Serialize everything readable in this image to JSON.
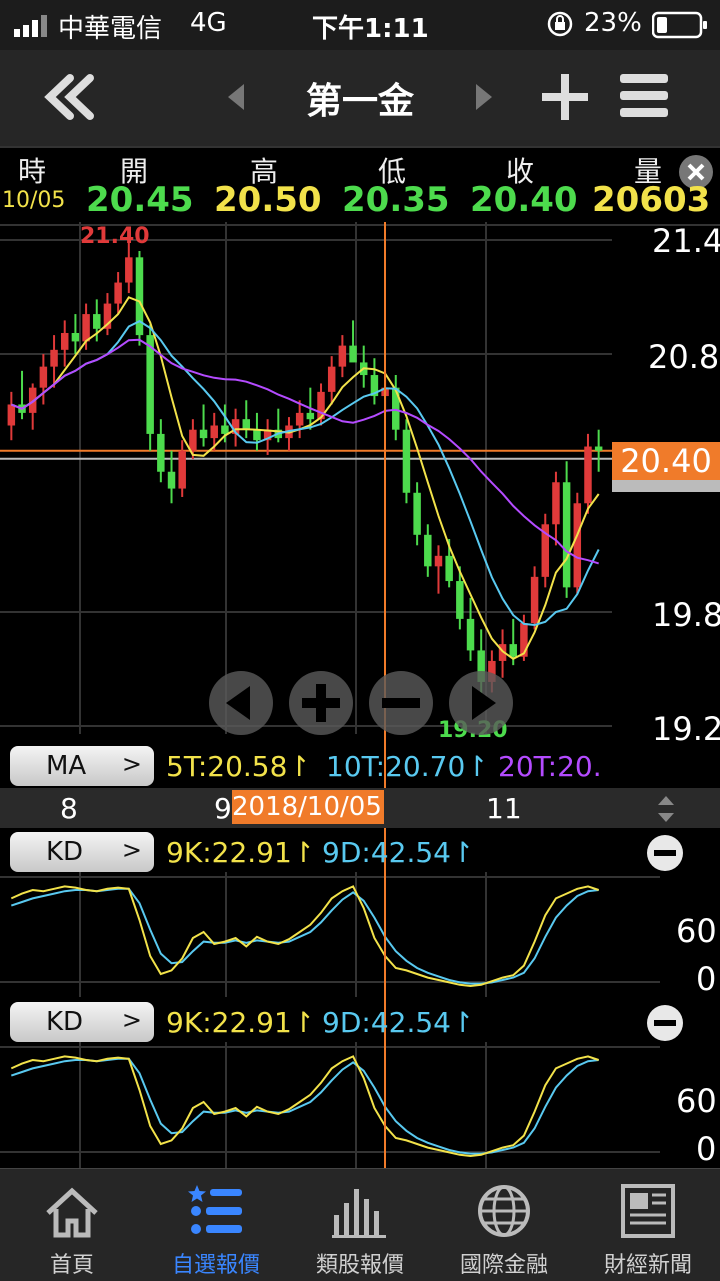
{
  "status": {
    "carrier": "中華電信",
    "network": "4G",
    "time": "下午1:11",
    "battery": "23%"
  },
  "nav": {
    "title": "第一金"
  },
  "quote": {
    "headers": [
      "時",
      "開",
      "高",
      "低",
      "收",
      "量"
    ],
    "date": "10/05",
    "open": "20.45",
    "high": "20.50",
    "low": "20.35",
    "close": "20.40",
    "volume": "20603"
  },
  "chart_data": {
    "type": "candlestick",
    "price_axis": [
      "21.4",
      "20.8",
      "19.8",
      "19.2"
    ],
    "current_price": "20.40",
    "high_label": "21.40",
    "low_label": "19.20",
    "date_axis": [
      "8",
      "9",
      "11"
    ],
    "cursor_date": "2018/10/05",
    "ylim": [
      19.1,
      21.45
    ],
    "candles": [
      [
        20.52,
        20.68,
        20.45,
        20.62
      ],
      [
        20.62,
        20.78,
        20.55,
        20.58
      ],
      [
        20.58,
        20.72,
        20.5,
        20.7
      ],
      [
        20.7,
        20.86,
        20.62,
        20.8
      ],
      [
        20.8,
        20.95,
        20.7,
        20.88
      ],
      [
        20.88,
        21.02,
        20.8,
        20.96
      ],
      [
        20.96,
        21.05,
        20.86,
        20.92
      ],
      [
        20.92,
        21.1,
        20.88,
        21.05
      ],
      [
        21.05,
        21.12,
        20.92,
        20.98
      ],
      [
        20.98,
        21.15,
        20.95,
        21.1
      ],
      [
        21.1,
        21.25,
        21.05,
        21.2
      ],
      [
        21.2,
        21.4,
        21.15,
        21.32
      ],
      [
        21.32,
        21.35,
        20.9,
        20.95
      ],
      [
        20.95,
        21.0,
        20.4,
        20.48
      ],
      [
        20.48,
        20.55,
        20.25,
        20.3
      ],
      [
        20.3,
        20.4,
        20.15,
        20.22
      ],
      [
        20.22,
        20.45,
        20.18,
        20.4
      ],
      [
        20.4,
        20.55,
        20.36,
        20.5
      ],
      [
        20.5,
        20.62,
        20.42,
        20.46
      ],
      [
        20.46,
        20.58,
        20.4,
        20.52
      ],
      [
        20.52,
        20.62,
        20.44,
        20.48
      ],
      [
        20.48,
        20.6,
        20.42,
        20.55
      ],
      [
        20.55,
        20.64,
        20.46,
        20.5
      ],
      [
        20.5,
        20.58,
        20.4,
        20.45
      ],
      [
        20.45,
        20.55,
        20.38,
        20.5
      ],
      [
        20.5,
        20.6,
        20.44,
        20.46
      ],
      [
        20.46,
        20.56,
        20.4,
        20.52
      ],
      [
        20.52,
        20.64,
        20.46,
        20.58
      ],
      [
        20.58,
        20.7,
        20.5,
        20.55
      ],
      [
        20.55,
        20.72,
        20.52,
        20.68
      ],
      [
        20.68,
        20.85,
        20.62,
        20.8
      ],
      [
        20.8,
        20.95,
        20.75,
        20.9
      ],
      [
        20.9,
        21.02,
        20.84,
        20.82
      ],
      [
        20.82,
        20.9,
        20.7,
        20.76
      ],
      [
        20.76,
        20.84,
        20.62,
        20.66
      ],
      [
        20.66,
        20.78,
        20.58,
        20.7
      ],
      [
        20.7,
        20.76,
        20.45,
        20.5
      ],
      [
        20.5,
        20.55,
        20.15,
        20.2
      ],
      [
        20.2,
        20.25,
        19.95,
        20.0
      ],
      [
        20.0,
        20.05,
        19.8,
        19.85
      ],
      [
        19.85,
        19.95,
        19.72,
        19.9
      ],
      [
        19.9,
        19.98,
        19.75,
        19.78
      ],
      [
        19.78,
        19.85,
        19.55,
        19.6
      ],
      [
        19.6,
        19.7,
        19.4,
        19.45
      ],
      [
        19.45,
        19.55,
        19.2,
        19.3
      ],
      [
        19.3,
        19.45,
        19.25,
        19.4
      ],
      [
        19.4,
        19.55,
        19.32,
        19.48
      ],
      [
        19.48,
        19.6,
        19.38,
        19.42
      ],
      [
        19.42,
        19.62,
        19.4,
        19.58
      ],
      [
        19.58,
        19.85,
        19.55,
        19.8
      ],
      [
        19.8,
        20.1,
        19.75,
        20.05
      ],
      [
        20.05,
        20.3,
        19.95,
        20.25
      ],
      [
        20.25,
        20.35,
        19.7,
        19.75
      ],
      [
        19.75,
        20.2,
        19.72,
        20.15
      ],
      [
        20.15,
        20.48,
        20.1,
        20.42
      ],
      [
        20.42,
        20.5,
        20.3,
        20.4
      ]
    ],
    "ma": [
      {
        "name": "5T",
        "value": "20.58",
        "color": "#f2e24a"
      },
      {
        "name": "10T",
        "value": "20.70",
        "color": "#59c9f0"
      },
      {
        "name": "20T",
        "value": "20.",
        "color": "#b44bff"
      }
    ],
    "kd": {
      "k_label": "9K",
      "k_value": "22.91",
      "d_label": "9D",
      "d_value": "42.54",
      "axis": [
        "60",
        "0"
      ],
      "k": [
        78,
        82,
        85,
        84,
        86,
        88,
        87,
        85,
        84,
        86,
        87,
        86,
        60,
        30,
        15,
        18,
        28,
        45,
        50,
        40,
        42,
        45,
        38,
        46,
        42,
        40,
        44,
        50,
        56,
        66,
        78,
        84,
        88,
        70,
        45,
        30,
        20,
        18,
        15,
        12,
        10,
        8,
        6,
        5,
        6,
        9,
        12,
        14,
        22,
        42,
        64,
        78,
        82,
        86,
        88,
        85
      ],
      "d": [
        72,
        75,
        78,
        80,
        82,
        84,
        85,
        85,
        84,
        85,
        86,
        86,
        74,
        52,
        32,
        24,
        25,
        34,
        42,
        41,
        41,
        43,
        41,
        43,
        42,
        41,
        42,
        46,
        50,
        58,
        68,
        77,
        83,
        76,
        62,
        46,
        34,
        26,
        20,
        16,
        13,
        10,
        8,
        7,
        7,
        8,
        10,
        12,
        16,
        28,
        46,
        62,
        72,
        80,
        84,
        85
      ]
    }
  },
  "ma_button": "MA",
  "kd_button": "KD",
  "tabs": [
    "首頁",
    "自選報價",
    "類股報價",
    "國際金融",
    "財經新聞"
  ],
  "colors": {
    "up": "#e03a3a",
    "down": "#4ddb4d",
    "accent": "#f07b2a",
    "tab_active": "#3a86ff"
  }
}
